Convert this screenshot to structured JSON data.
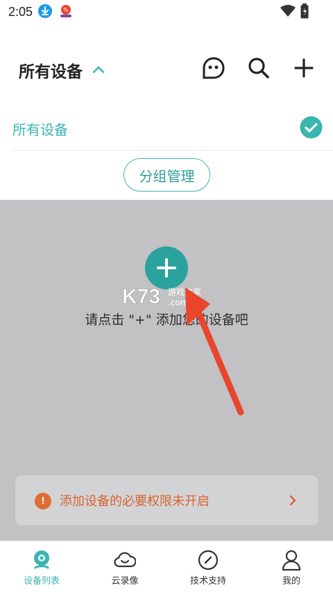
{
  "status_bar": {
    "time": "2:05"
  },
  "header": {
    "title": "所有设备"
  },
  "groups": {
    "items": [
      {
        "label": "所有设备",
        "selected": true
      }
    ],
    "manage_label": "分组管理"
  },
  "empty_state": {
    "hint": "请点击 \"+\" 添加您的设备吧"
  },
  "watermark": {
    "text": "K73 游戏之家 .com"
  },
  "permission_banner": {
    "text": "添加设备的必要权限未开启"
  },
  "bottom_nav": {
    "items": [
      {
        "label": "设备列表",
        "icon": "camera-icon",
        "active": true
      },
      {
        "label": "云录像",
        "icon": "cloud-icon",
        "active": false
      },
      {
        "label": "技术支持",
        "icon": "compass-icon",
        "active": false
      },
      {
        "label": "我的",
        "icon": "user-icon",
        "active": false
      }
    ]
  },
  "colors": {
    "accent": "#3ab5b0",
    "warning": "#d86430",
    "overlay": "#c2c1c3"
  }
}
